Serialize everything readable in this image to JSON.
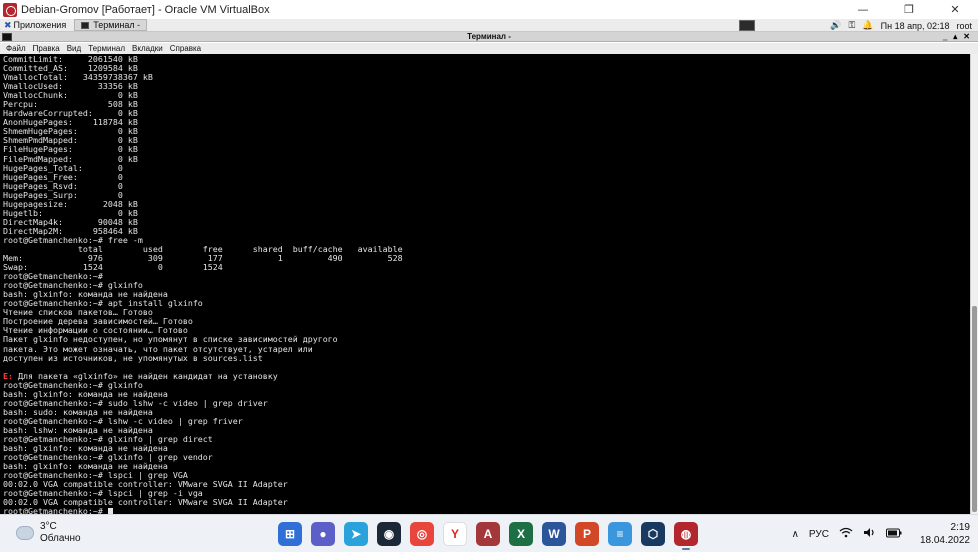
{
  "host_window": {
    "title": "Debian-Gromov [Работает] - Oracle VM VirtualBox",
    "minimize": "—",
    "restore": "❐",
    "close": "✕"
  },
  "guest_panel": {
    "apps_label": "Приложения",
    "task_label": "Терминал -",
    "keyboard": "▤",
    "tray_icons": [
      "🔊",
      "⚿",
      "🔔"
    ],
    "datetime": "Пн 18 апр, 02:18",
    "user_label": "root"
  },
  "terminal": {
    "title": "Терминал -",
    "controls": [
      "‗",
      "▴",
      "✕"
    ],
    "menu": [
      "Файл",
      "Правка",
      "Вид",
      "Терминал",
      "Вкладки",
      "Справка"
    ],
    "lines": [
      "CommitLimit:     2061540 kB",
      "Committed_AS:    1209584 kB",
      "VmallocTotal:   34359738367 kB",
      "VmallocUsed:       33356 kB",
      "VmallocChunk:          0 kB",
      "Percpu:              508 kB",
      "HardwareCorrupted:     0 kB",
      "AnonHugePages:    118784 kB",
      "ShmemHugePages:        0 kB",
      "ShmemPmdMapped:        0 kB",
      "FileHugePages:         0 kB",
      "FilePmdMapped:         0 kB",
      "HugePages_Total:       0",
      "HugePages_Free:        0",
      "HugePages_Rsvd:        0",
      "HugePages_Surp:        0",
      "Hugepagesize:       2048 kB",
      "Hugetlb:               0 kB",
      "DirectMap4k:       90048 kB",
      "DirectMap2M:      958464 kB",
      "root@Getmanchenko:~# free -m",
      "               total        used        free      shared  buff/cache   available",
      "Mem:             976         309         177           1         490         528",
      "Swap:           1524           0        1524",
      "root@Getmanchenko:~#",
      "root@Getmanchenko:~# glxinfo",
      "bash: glxinfo: команда не найдена",
      "root@Getmanchenko:~# apt install glxinfo",
      "Чтение списков пакетов… Готово",
      "Построение дерева зависимостей… Готово",
      "Чтение информации о состоянии… Готово",
      "Пакет glxinfo недоступен, но упомянут в списке зависимостей другого",
      "пакета. Это может означать, что пакет отсутствует, устарел или",
      "доступен из источников, не упомянутых в sources.list",
      "",
      "E: Для пакета «glxinfo» не найден кандидат на установку",
      "root@Getmanchenko:~# glxinfo",
      "bash: glxinfo: команда не найдена",
      "root@Getmanchenko:~# sudo lshw -c video | grep driver",
      "bash: sudo: команда не найдена",
      "root@Getmanchenko:~# lshw -c video | grep friver",
      "bash: lshw: команда не найдена",
      "root@Getmanchenko:~# glxinfo | grep direct",
      "bash: glxinfo: команда не найдена",
      "root@Getmanchenko:~# glxinfo | grep vendor",
      "bash: glxinfo: команда не найдена",
      "root@Getmanchenko:~# lspci | grep VGA",
      "00:02.0 VGA compatible controller: VMware SVGA II Adapter",
      "root@Getmanchenko:~# lspci | grep -i vga",
      "00:02.0 VGA compatible controller: VMware SVGA II Adapter",
      "root@Getmanchenko:~# "
    ],
    "error_prefix": "E:",
    "error_rest": " Для пакета «glxinfo» не найден кандидат на установку"
  },
  "windows_taskbar": {
    "weather_temp": "3°C",
    "weather_desc": "Облачно",
    "apps": [
      {
        "name": "windows-start-icon",
        "glyph": "⊞",
        "color": "#2f6fd6"
      },
      {
        "name": "chat-icon",
        "glyph": "●",
        "color": "#5b5fc7"
      },
      {
        "name": "telegram-icon",
        "glyph": "➤",
        "color": "#2aa3dc"
      },
      {
        "name": "steam-icon",
        "glyph": "◉",
        "color": "#1b2838"
      },
      {
        "name": "chrome-icon",
        "glyph": "◎",
        "color": "#e8453c"
      },
      {
        "name": "yandex-icon",
        "glyph": "Y",
        "color": "#ffffff"
      },
      {
        "name": "access-icon",
        "glyph": "A",
        "color": "#a4373a"
      },
      {
        "name": "excel-icon",
        "glyph": "X",
        "color": "#1d7044"
      },
      {
        "name": "word-icon",
        "glyph": "W",
        "color": "#2b579a"
      },
      {
        "name": "powerpoint-icon",
        "glyph": "P",
        "color": "#d24726"
      },
      {
        "name": "notepad-icon",
        "glyph": "≡",
        "color": "#3a96dd"
      },
      {
        "name": "virtualbox-icon",
        "glyph": "⬡",
        "color": "#183a61"
      },
      {
        "name": "debian-vm-icon",
        "glyph": "◍",
        "color": "#b3262d"
      }
    ],
    "tray_chevron": "∧",
    "language": "РУС",
    "tray_icons": [
      "wifi-icon",
      "volume-icon",
      "battery-icon"
    ],
    "time": "2:19",
    "date": "18.04.2022"
  }
}
